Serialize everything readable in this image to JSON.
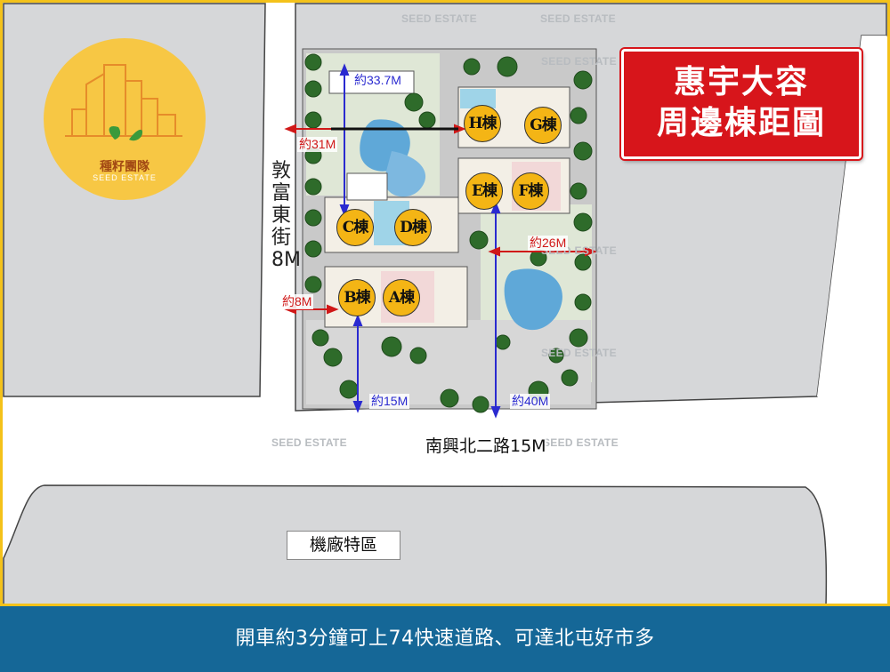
{
  "title": {
    "line1": "惠宇大容",
    "line2": "周邊棟距圖"
  },
  "logo": {
    "name_zh": "種籽團隊",
    "name_en": "SEED ESTATE"
  },
  "watermark": "SEED ESTATE",
  "buildings": [
    "H棟",
    "G棟",
    "E棟",
    "F棟",
    "C棟",
    "D棟",
    "B棟",
    "A棟"
  ],
  "distances": {
    "top": "約33.7M",
    "left_upper": "約31M",
    "right_mid": "約26M",
    "left_lower": "約8M",
    "bottom_left": "約15M",
    "bottom_right": "約40M"
  },
  "streets": {
    "west": "敦富東街8M",
    "south": "南興北二路15M"
  },
  "zone": "機廠特區",
  "footer": "開車約3分鐘可上74快速道路、可達北屯好市多",
  "colors": {
    "background_map": "#d6d7d9",
    "road": "#ffffff",
    "border": "#f4c21a",
    "title_box": "#d7151b",
    "footer": "#156797",
    "building_marker": "#f4b515"
  }
}
